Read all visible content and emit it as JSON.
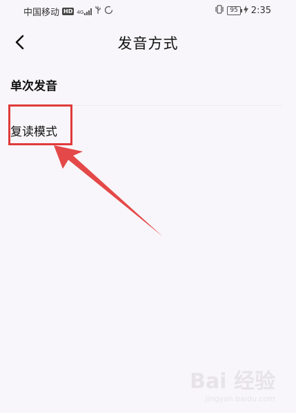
{
  "status_bar": {
    "carrier": "中国移动",
    "hd_badge": "HD",
    "network": "4G",
    "battery_level": "95",
    "time": "2:35"
  },
  "header": {
    "title": "发音方式"
  },
  "options": {
    "single": "单次发音",
    "repeat": "复读模式"
  },
  "watermark": {
    "brand": "Bai 经验",
    "url": "jingyan.baidu.com"
  },
  "colors": {
    "background": "#f8f6fa",
    "annotation_red": "#e03a3a"
  }
}
